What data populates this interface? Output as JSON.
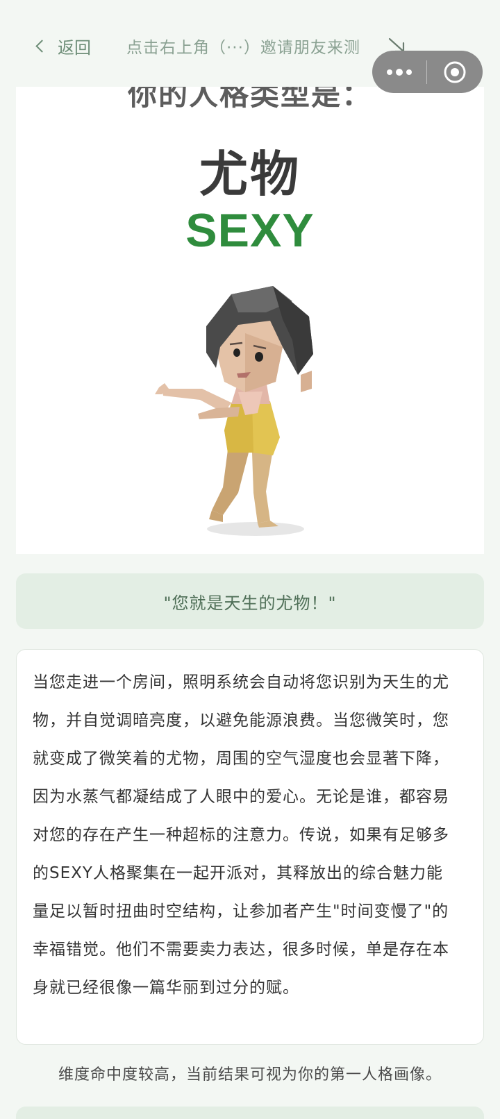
{
  "nav": {
    "back_label": "返回",
    "invite_hint": "点击右上角（···）邀请朋友来测"
  },
  "result": {
    "pre_title": "你的人格类型是：",
    "type_cn": "尤物",
    "type_en": "SEXY"
  },
  "quote": "\"您就是天生的尤物！\"",
  "description": "当您走进一个房间，照明系统会自动将您识别为天生的尤物，并自觉调暗亮度，以避免能源浪费。当您微笑时，您就变成了微笑着的尤物，周围的空气湿度也会显著下降，因为水蒸气都凝结成了人眼中的爱心。无论是谁，都容易对您的存在产生一种超标的注意力。传说，如果有足够多的SEXY人格聚集在一起开派对，其释放出的综合魅力能量足以暂时扭曲时空结构，让参加者产生\"时间变慢了\"的幸福错觉。他们不需要卖力表达，很多时候，单是存在本身就已经很像一篇华丽到过分的赋。",
  "footnote": "维度命中度较高，当前结果可视为你的第一人格画像。",
  "colors": {
    "background": "#f3f7f3",
    "accent_green": "#2f8c3d",
    "quote_bg": "#e3eee4",
    "nav_text": "#6e8e78",
    "capsule_bg": "#8a8a8a"
  },
  "icons": {
    "back": "chevron-left-icon",
    "arrow": "arrow-down-right-icon",
    "more": "more-dots-icon",
    "close": "target-close-icon"
  }
}
